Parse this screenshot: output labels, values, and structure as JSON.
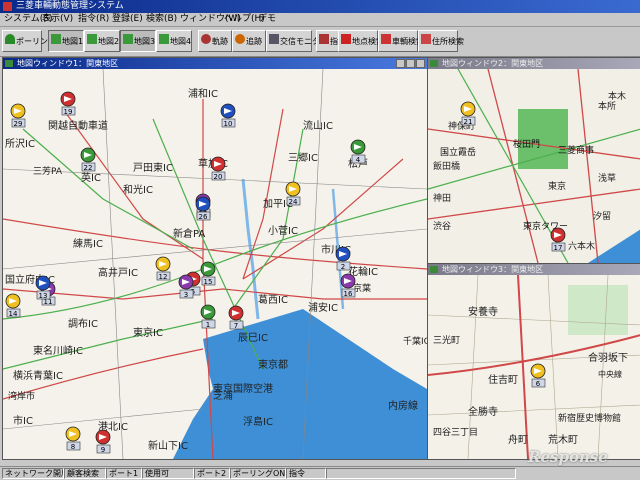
{
  "app": {
    "title": "三菱車輛動態管理システム"
  },
  "menu": [
    "システム(S)",
    "表示(V)",
    "指令(R)",
    "登録(E)",
    "検索(B)",
    "ウィンドウ(W)",
    "ヘルプ(H)",
    "デモ"
  ],
  "toolbar": {
    "buttons": [
      {
        "label": "ポーリング",
        "active": false
      },
      {
        "label": "地図1",
        "active": true
      },
      {
        "label": "地図2",
        "active": false
      },
      {
        "label": "地図3",
        "active": true
      },
      {
        "label": "地図4",
        "active": false
      },
      {
        "label": "軌跡",
        "active": false
      },
      {
        "label": "追跡",
        "active": false
      },
      {
        "label": "交信モニタ",
        "active": false
      },
      {
        "label": "指令",
        "active": false
      },
      {
        "label": "地点検索",
        "active": false
      },
      {
        "label": "車輌検索",
        "active": false
      },
      {
        "label": "住所検索",
        "active": false
      }
    ]
  },
  "windows": {
    "main": {
      "title": "地図ウィンドウ1：関東地区"
    },
    "right_top": {
      "title": "地図ウィンドウ2：関東地区"
    },
    "right_bottom": {
      "title": "地図ウィンドウ3：関東地区"
    }
  },
  "map_main": {
    "labels": [
      "浦和IC",
      "所沢IC",
      "関越自動車道",
      "流山IC",
      "三芳PA",
      "英IC",
      "戸田東IC",
      "草加IC",
      "三郷IC",
      "和光IC",
      "松戸",
      "新倉PA",
      "加平IC",
      "練馬IC",
      "小菅IC",
      "市川IC",
      "高井戸IC",
      "国立府中IC",
      "花輪IC",
      "調布IC",
      "葛西IC",
      "浦安IC",
      "東京IC",
      "辰巳IC",
      "千葉IC",
      "東名川崎IC",
      "東京都",
      "湾岸市",
      "芝浦",
      "横浜青葉IC",
      "東京国際空港",
      "市IC",
      "浮島IC",
      "港北IC",
      "新山下IC",
      "内房線",
      "京葉"
    ],
    "vehicles": [
      "29",
      "19",
      "10",
      "22",
      "25",
      "24",
      "20",
      "26",
      "4",
      "11",
      "12",
      "5",
      "13",
      "1",
      "3",
      "14",
      "7",
      "2",
      "15",
      "16",
      "8",
      "9"
    ]
  },
  "map_tr": {
    "labels": [
      "国立霞岳",
      "三菱商事",
      "東京タワー",
      "桜田門",
      "汐留",
      "本所",
      "飯田橋",
      "神田",
      "浅草",
      "東京",
      "渋谷",
      "六本木",
      "本木",
      "神保町"
    ],
    "vehicles": [
      "21",
      "17"
    ]
  },
  "map_br": {
    "labels": [
      "住吉町",
      "安養寺",
      "全勝寺",
      "合羽坂下",
      "舟町",
      "荒木町",
      "新宿歴史博物館",
      "四谷三丁目",
      "中央線",
      "三光町"
    ],
    "vehicles": [
      "6"
    ]
  },
  "status": {
    "cells": [
      "ネットワーク開局",
      "顧客検索",
      "ポート1",
      "使用可",
      "ポート2",
      "ポーリングON",
      "指令"
    ]
  },
  "watermark": "Response"
}
